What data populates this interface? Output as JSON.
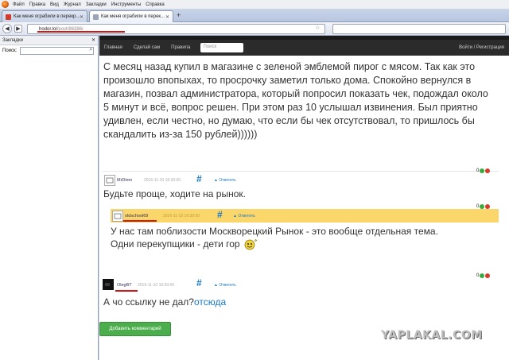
{
  "browser": {
    "menu": [
      "Файл",
      "Правка",
      "Вид",
      "Журнал",
      "Закладки",
      "Инструменты",
      "Справка"
    ],
    "tabs": [
      {
        "title": "Как меня ограбили в перекр...",
        "active": false
      },
      {
        "title": "Как меня ограбили в перек...",
        "active": true
      }
    ],
    "url_host": "hodor.lol",
    "url_path": "/post/86386/"
  },
  "sidebar": {
    "title": "Закладки",
    "search_label": "Поиск:"
  },
  "site": {
    "nav": [
      "Главная",
      "Сделай сам",
      "Правила"
    ],
    "search_placeholder": "Поиск",
    "login": "Войти / Регистрация"
  },
  "post": {
    "text": "С месяц назад купил в магазине с зеленой эмблемой пирог с мясом. Так как это произошло впопыхах, то просрочку заметил только дома. Спокойно вернулся в магазин, позвал администратора, который попросил показать чек, подождал около 5 минут и всё, вопрос решен. При этом раз 10 услышал извинения. Был приятно удивлен, если честно, но думаю, что если бы чек отсутствовал, то пришлось бы скандалить из-за 150 рублей))))))"
  },
  "comments": [
    {
      "user": "MrDimn",
      "date": "2016-11-10 16:30:00",
      "hash": "#",
      "reply": "Ответить",
      "score": "0",
      "text": "Будьте проще, ходите на рынок."
    },
    {
      "user": "oldschool69",
      "date": "2016-11-10 16:30:00",
      "hash": "#",
      "reply": "Ответить",
      "score": "0",
      "text1": "У нас там поблизости Москворецкий Рынок - это вообще отдельная тема.",
      "text2": "Одни перекупщики - дети гор"
    },
    {
      "user": "OlegBT",
      "date": "2016-11-10 16:30:00",
      "hash": "#",
      "reply": "Ответить",
      "score": "0",
      "text": "А чо ссылку не дал?",
      "link": "отсюда"
    }
  ],
  "add_comment": "Добавить комментарий",
  "watermark": "YAPLAKAL.COM",
  "colors": {
    "accent": "#1a78c2",
    "highlight": "#fbd66a",
    "button": "#4bad4b",
    "mark": "#d01818"
  }
}
